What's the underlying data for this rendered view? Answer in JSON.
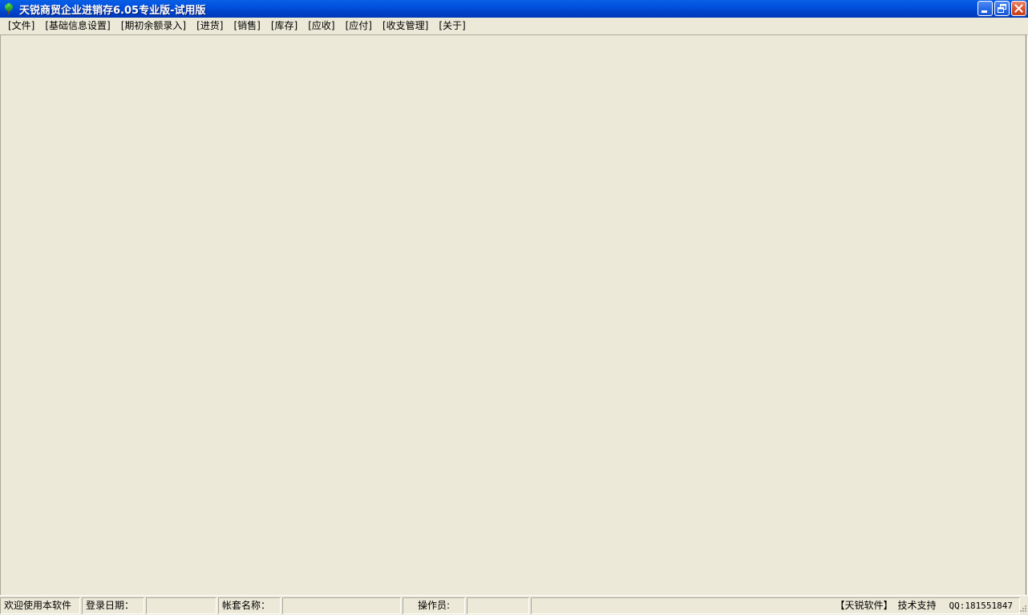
{
  "window": {
    "title": "天锐商贸企业进销存6.05专业版-试用版",
    "icon": "tree-icon"
  },
  "title_buttons": {
    "minimize_icon": "minimize-icon",
    "restore_icon": "restore-icon",
    "close_icon": "close-icon"
  },
  "menu": {
    "items": [
      {
        "label": "[文件]"
      },
      {
        "label": "[基础信息设置]"
      },
      {
        "label": "[期初余额录入]"
      },
      {
        "label": "[进货]"
      },
      {
        "label": "[销售]"
      },
      {
        "label": "[库存]"
      },
      {
        "label": "[应收]"
      },
      {
        "label": "[应付]"
      },
      {
        "label": "[收支管理]"
      },
      {
        "label": "[关于]"
      }
    ]
  },
  "statusbar": {
    "welcome": "欢迎使用本软件",
    "login_date_label": "登录日期：",
    "login_date_value": "",
    "account_label": "帐套名称：",
    "account_value": "",
    "operator_label": "操作员:",
    "operator_value": "",
    "brand": "【天锐软件】",
    "support": "技术支持",
    "qq": "QQ:181551847"
  },
  "colors": {
    "titlebar": "#0053E0",
    "face": "#ECE9D8",
    "close_button": "#D9542F"
  }
}
